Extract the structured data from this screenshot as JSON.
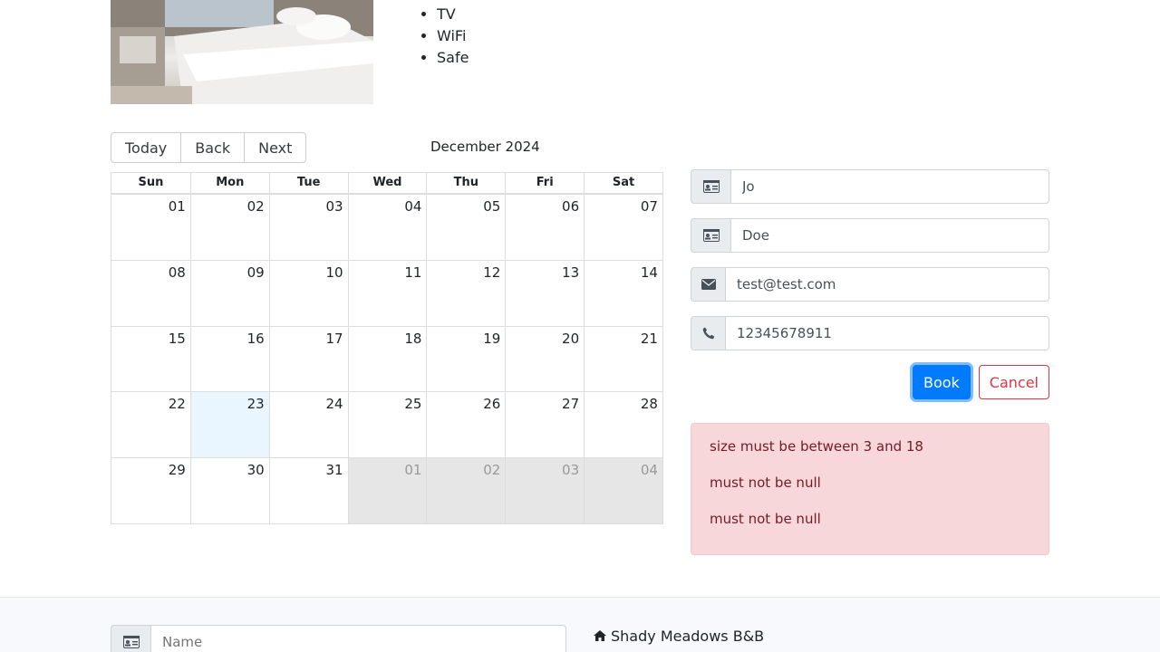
{
  "room": {
    "image_alt": "Room image",
    "features": [
      "TV",
      "WiFi",
      "Safe"
    ]
  },
  "calendar": {
    "toolbar": {
      "today": "Today",
      "back": "Back",
      "next": "Next"
    },
    "label": "December 2024",
    "weekdays": [
      "Sun",
      "Mon",
      "Tue",
      "Wed",
      "Thu",
      "Fri",
      "Sat"
    ],
    "weeks": [
      [
        "01",
        "02",
        "03",
        "04",
        "05",
        "06",
        "07"
      ],
      [
        "08",
        "09",
        "10",
        "11",
        "12",
        "13",
        "14"
      ],
      [
        "15",
        "16",
        "17",
        "18",
        "19",
        "20",
        "21"
      ],
      [
        "22",
        "23",
        "24",
        "25",
        "26",
        "27",
        "28"
      ],
      [
        "29",
        "30",
        "31",
        "01",
        "02",
        "03",
        "04"
      ]
    ]
  },
  "booking": {
    "firstname": {
      "value": "Jo",
      "icon": "id-card-icon"
    },
    "lastname": {
      "value": "Doe",
      "icon": "id-card-icon"
    },
    "email": {
      "value": "test@test.com",
      "icon": "envelope-icon"
    },
    "phone": {
      "value": "12345678911",
      "icon": "phone-icon"
    },
    "book_label": "Book",
    "cancel_label": "Cancel"
  },
  "errors": [
    "size must be between 3 and 18",
    "must not be null",
    "must not be null"
  ],
  "footer": {
    "name_placeholder": "Name",
    "brand": "Shady Meadows B&B"
  },
  "colors": {
    "primary": "#007bff",
    "danger": "#dc3545",
    "alert_bg": "#f8d7da",
    "today_bg": "#eaf6ff"
  }
}
